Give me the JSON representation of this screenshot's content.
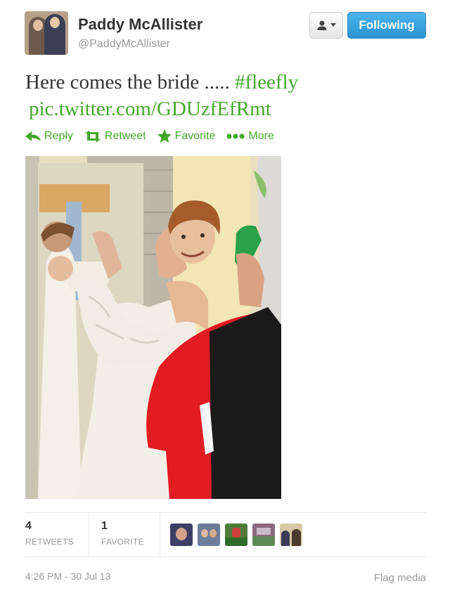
{
  "user": {
    "name": "Paddy McAllister",
    "handle": "@PaddyMcAllister"
  },
  "buttons": {
    "user_menu_icon": "person-dropdown-icon",
    "follow_label": "Following"
  },
  "tweet": {
    "text": "Here comes the bride .....",
    "hashtag": "#fleefly",
    "link": "pic.twitter.com/GDUzfEfRmt"
  },
  "actions": [
    {
      "label": "Reply",
      "icon": "reply-icon"
    },
    {
      "label": "Retweet",
      "icon": "retweet-icon"
    },
    {
      "label": "Favorite",
      "icon": "star-icon"
    },
    {
      "label": "More",
      "icon": "more-dots-icon"
    }
  ],
  "stats": {
    "retweets_count": "4",
    "retweets_label": "RETWEETS",
    "favorites_count": "1",
    "favorites_label": "FAVORITE"
  },
  "footer": {
    "timestamp": "4:26 PM - 30 Jul 13",
    "flag_label": "Flag media"
  },
  "colors": {
    "link_green": "#44a82c",
    "follow_blue": "#2a93d2",
    "muted": "#999999"
  }
}
